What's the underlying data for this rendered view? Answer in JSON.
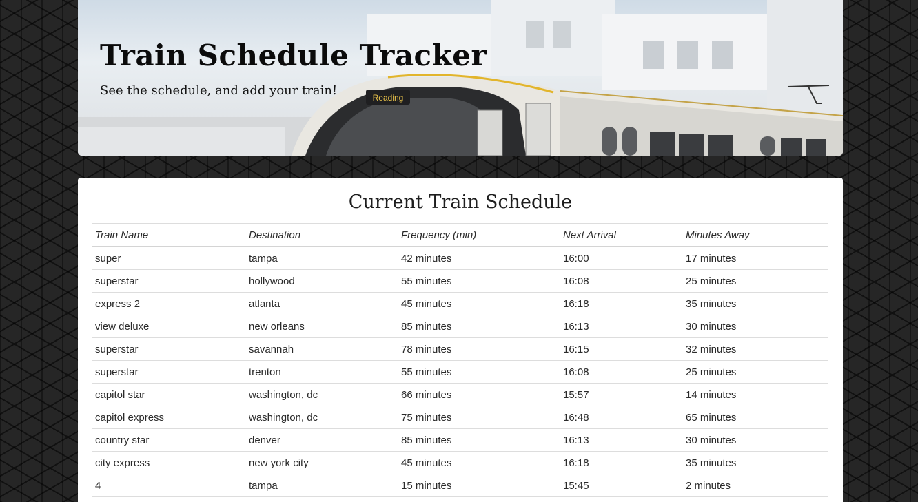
{
  "header": {
    "title": "Train Schedule Tracker",
    "subtitle": "See the schedule, and add your train!",
    "train_sign": "Reading"
  },
  "schedule": {
    "title": "Current Train Schedule",
    "columns": [
      "Train Name",
      "Destination",
      "Frequency (min)",
      "Next Arrival",
      "Minutes Away"
    ],
    "rows": [
      [
        "super",
        "tampa",
        "42 minutes",
        "16:00",
        "17 minutes"
      ],
      [
        "superstar",
        "hollywood",
        "55 minutes",
        "16:08",
        "25 minutes"
      ],
      [
        "express 2",
        "atlanta",
        "45 minutes",
        "16:18",
        "35 minutes"
      ],
      [
        "view deluxe",
        "new orleans",
        "85 minutes",
        "16:13",
        "30 minutes"
      ],
      [
        "superstar",
        "savannah",
        "78 minutes",
        "16:15",
        "32 minutes"
      ],
      [
        "superstar",
        "trenton",
        "55 minutes",
        "16:08",
        "25 minutes"
      ],
      [
        "capitol star",
        "washington, dc",
        "66 minutes",
        "15:57",
        "14 minutes"
      ],
      [
        "capitol express",
        "washington, dc",
        "75 minutes",
        "16:48",
        "65 minutes"
      ],
      [
        "country star",
        "denver",
        "85 minutes",
        "16:13",
        "30 minutes"
      ],
      [
        "city express",
        "new york city",
        "45 minutes",
        "16:18",
        "35 minutes"
      ],
      [
        "4",
        "tampa",
        "15 minutes",
        "15:45",
        "2 minutes"
      ]
    ]
  }
}
